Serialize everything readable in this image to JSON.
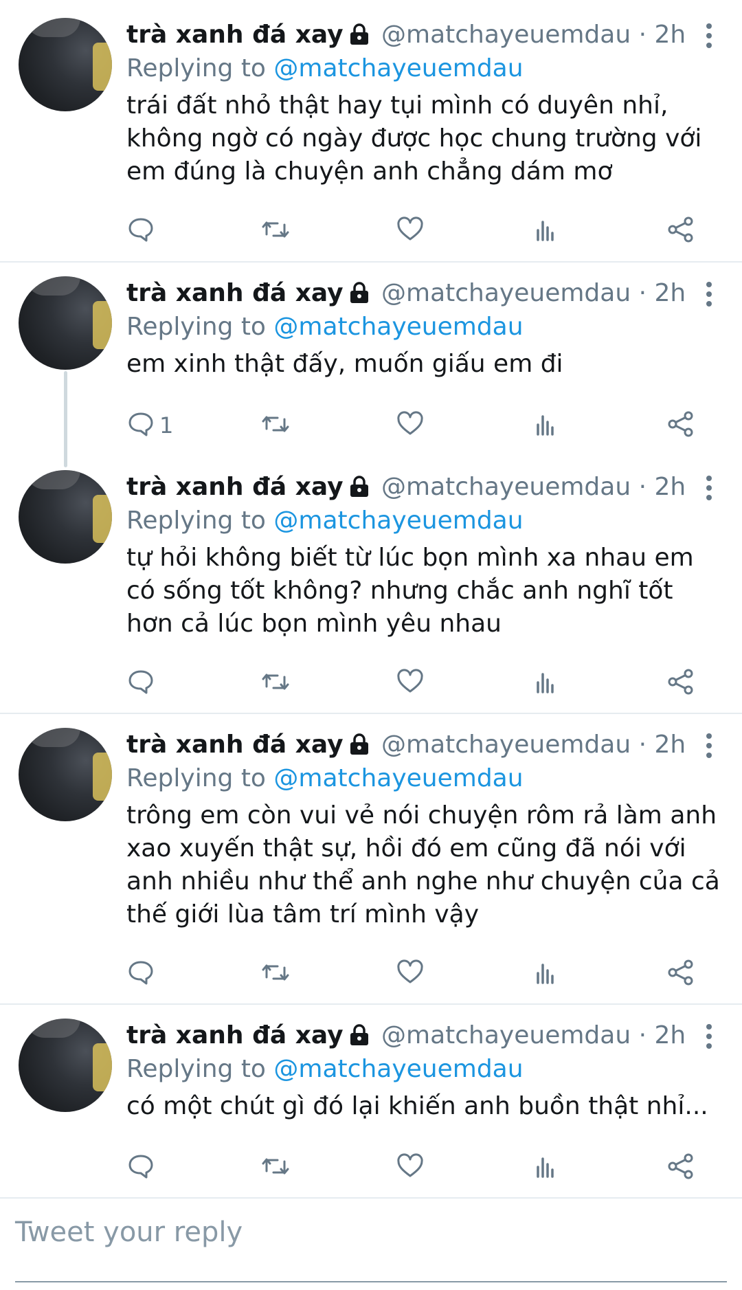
{
  "colors": {
    "name": "#14171a",
    "muted": "#657786",
    "accent": "#1b95e0",
    "divider": "#e6ecf0"
  },
  "tweets": [
    {
      "author_name": "trà xanh đá xay",
      "handle": "@matchayeuemdau",
      "separator": "·",
      "time": "2h",
      "replying_prefix": "Replying to",
      "replying_to": "@matchayeuemdau",
      "lines": [
        "trái đất nhỏ thật hay tụi mình có duyên nhỉ,",
        "không ngờ có ngày được học chung trường với",
        "em đúng là chuyện anh chẳng dám mơ"
      ],
      "reply_count": ""
    },
    {
      "author_name": "trà xanh đá xay",
      "handle": "@matchayeuemdau",
      "separator": "·",
      "time": "2h",
      "replying_prefix": "Replying to",
      "replying_to": "@matchayeuemdau",
      "lines": [
        "em xinh thật đấy, muốn giấu em đi"
      ],
      "reply_count": "1"
    },
    {
      "author_name": "trà xanh đá xay",
      "handle": "@matchayeuemdau",
      "separator": "·",
      "time": "2h",
      "replying_prefix": "Replying to",
      "replying_to": "@matchayeuemdau",
      "lines": [
        "tự hỏi không biết từ lúc bọn mình xa nhau em",
        "có sống tốt không? nhưng chắc anh nghĩ tốt",
        "hơn cả lúc bọn mình yêu nhau"
      ],
      "reply_count": ""
    },
    {
      "author_name": "trà xanh đá xay",
      "handle": "@matchayeuemdau",
      "separator": "·",
      "time": "2h",
      "replying_prefix": "Replying to",
      "replying_to": "@matchayeuemdau",
      "lines": [
        "trông em còn vui vẻ nói chuyện rôm rả làm anh",
        "xao xuyến thật sự, hồi đó em cũng đã nói với",
        "anh nhiều như thể anh nghe như chuyện của cả",
        "thế giới lùa tâm trí mình vậy"
      ],
      "reply_count": ""
    },
    {
      "author_name": "trà xanh đá xay",
      "handle": "@matchayeuemdau",
      "separator": "·",
      "time": "2h",
      "replying_prefix": "Replying to",
      "replying_to": "@matchayeuemdau",
      "lines": [
        "có một chút gì đó lại khiến anh buồn thật nhỉ..."
      ],
      "reply_count": ""
    }
  ],
  "icons": {
    "reply": "reply-icon",
    "retweet": "retweet-icon",
    "like": "like-icon",
    "analytics": "analytics-icon",
    "share": "share-icon",
    "more": "more-icon",
    "lock": "lock-icon"
  },
  "composer": {
    "placeholder": "Tweet your reply"
  }
}
